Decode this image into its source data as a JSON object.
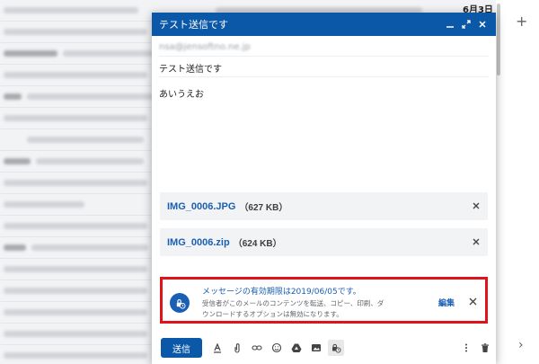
{
  "inbox": {
    "date": "6月3日"
  },
  "compose": {
    "title": "テスト送信です",
    "to_address": "nsa@jensoftno.ne.jp",
    "subject": "テスト送信です",
    "body": "あいうえお",
    "attachments": [
      {
        "name": "IMG_0006.JPG",
        "size": "（627 KB）"
      },
      {
        "name": "IMG_0006.zip",
        "size": "（624 KB）"
      }
    ],
    "confidential": {
      "title": "メッセージの有効期限は2019/06/05です。",
      "desc_line1": "受信者がこのメールのコンテンツを転送、コピー、印刷、ダ",
      "desc_line2": "ウンロードするオプションは無効になります。",
      "edit_label": "編集"
    },
    "send_label": "送信"
  },
  "rail": {
    "plus": "+",
    "chevron": "›"
  },
  "colors": {
    "accent": "#0b57a8",
    "highlight": "#e0121a",
    "link": "#1a5fb4"
  }
}
